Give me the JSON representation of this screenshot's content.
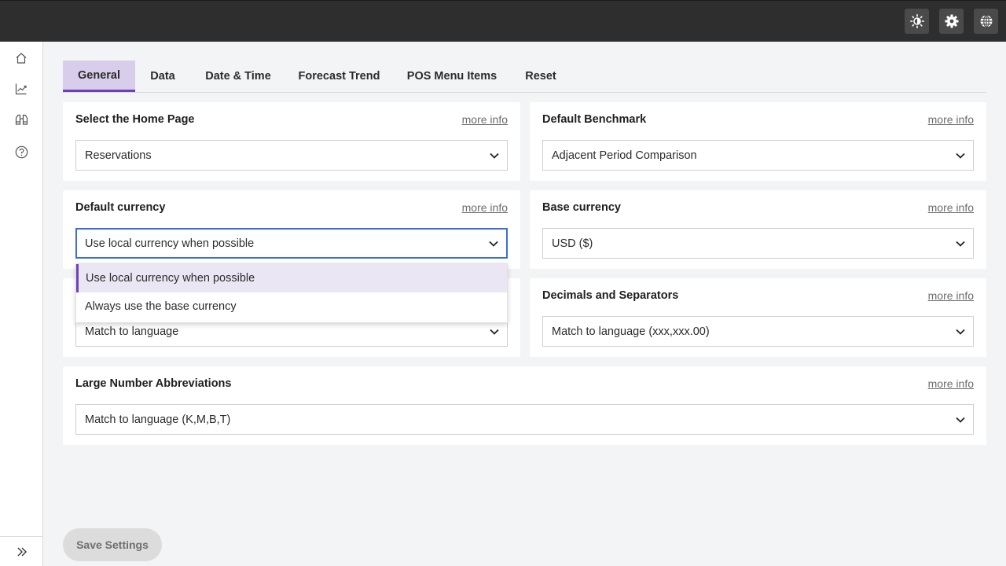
{
  "topbar": {
    "icons": [
      "theme-icon",
      "gear-icon",
      "globe-icon"
    ]
  },
  "sidebar": {
    "items": [
      {
        "icon": "home-icon"
      },
      {
        "icon": "trend-chart-icon"
      },
      {
        "icon": "binoculars-icon"
      },
      {
        "icon": "help-icon"
      }
    ],
    "expand_icon": "double-chevron-right-icon"
  },
  "tabs": [
    {
      "label": "General",
      "active": true
    },
    {
      "label": "Data"
    },
    {
      "label": "Date & Time"
    },
    {
      "label": "Forecast Trend"
    },
    {
      "label": "POS Menu Items"
    },
    {
      "label": "Reset"
    }
  ],
  "settings": {
    "home_page": {
      "title": "Select the Home Page",
      "more": "more info",
      "value": "Reservations"
    },
    "benchmark": {
      "title": "Default Benchmark",
      "more": "more info",
      "value": "Adjacent Period Comparison"
    },
    "default_currency": {
      "title": "Default currency",
      "more": "more info",
      "value": "Use local currency when possible",
      "options": [
        "Use local currency when possible",
        "Always use the base currency"
      ]
    },
    "base_currency": {
      "title": "Base currency",
      "more": "more info",
      "value": "USD ($)"
    },
    "number_format": {
      "value": "Match to language"
    },
    "decimals": {
      "title": "Decimals and Separators",
      "more": "more info",
      "value": "Match to language (xxx,xxx.00)"
    },
    "abbreviations": {
      "title": "Large Number Abbreviations",
      "more": "more info",
      "value": "Match to language (K,M,B,T)"
    }
  },
  "save_label": "Save Settings",
  "colors": {
    "accent": "#6f3fb5",
    "tab_active_bg": "#d9cdec",
    "focus_border": "#3a6fd8",
    "topbar": "#2e2e2e"
  }
}
